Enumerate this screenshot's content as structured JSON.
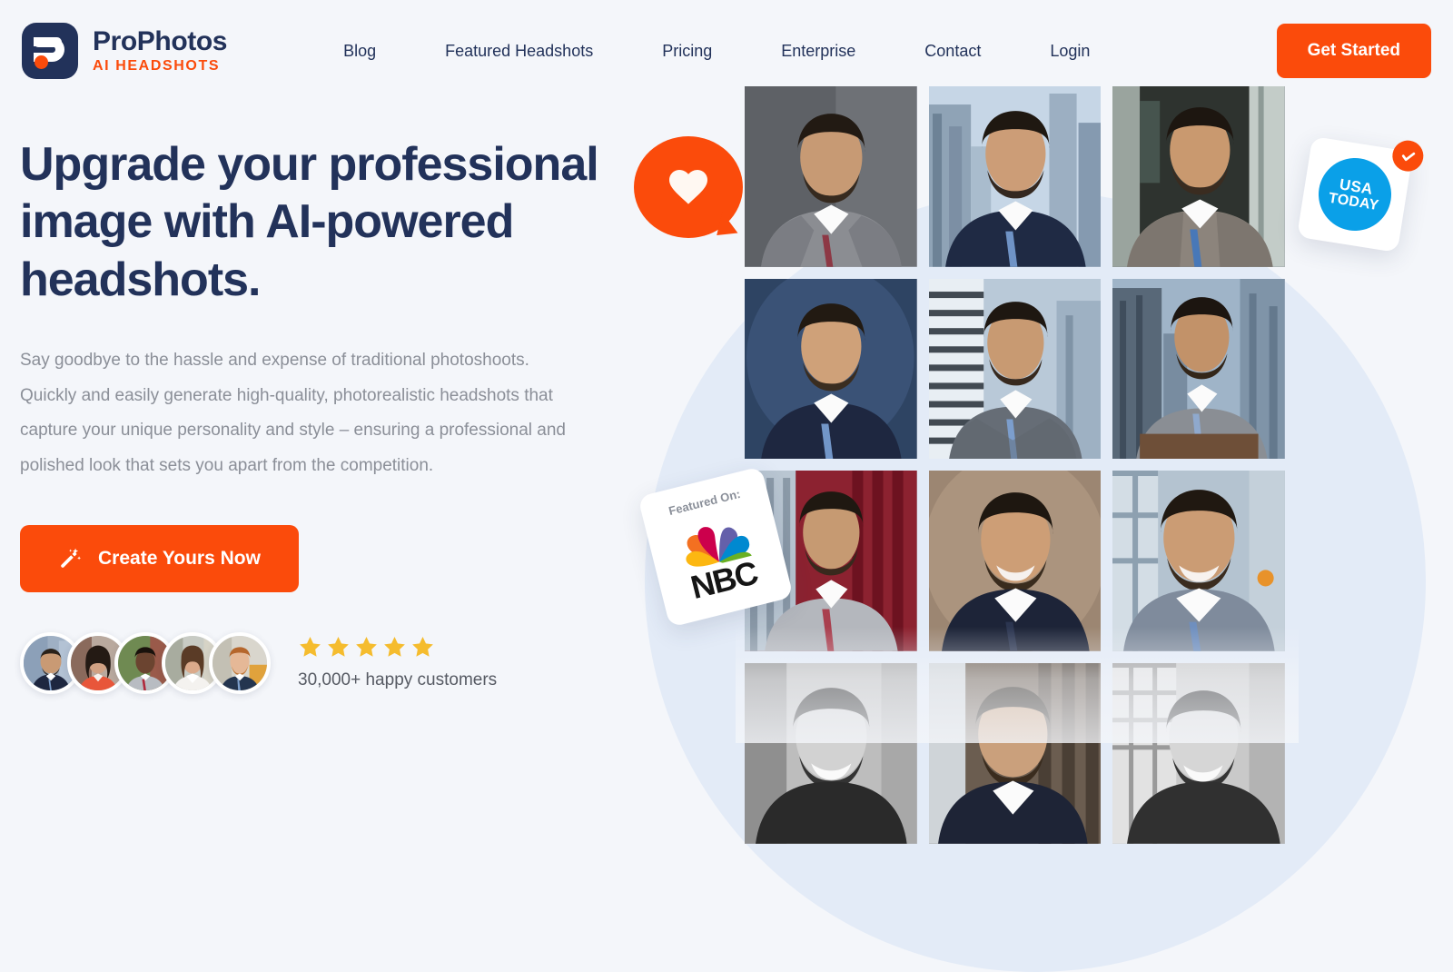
{
  "brand": {
    "name": "ProPhotos",
    "tagline": "AI HEADSHOTS",
    "mark_icon": "prophotos-logo-icon"
  },
  "nav": {
    "items": [
      {
        "label": "Blog"
      },
      {
        "label": "Featured Headshots"
      },
      {
        "label": "Pricing"
      },
      {
        "label": "Enterprise"
      },
      {
        "label": "Contact"
      },
      {
        "label": "Login"
      }
    ],
    "cta_label": "Get Started"
  },
  "hero": {
    "heading": "Upgrade your professional image with AI-powered headshots.",
    "paragraph": "Say goodbye to the hassle and expense of traditional photoshoots. Quickly and easily generate high-quality, photorealistic headshots that capture your unique personality and style – ensuring a professional and polished look that sets you apart from the competition.",
    "cta_label": "Create Yours Now",
    "cta_icon": "magic-wand-icon"
  },
  "social_proof": {
    "star_count": 5,
    "star_icon": "star-icon",
    "customers_text": "30,000+ happy customers",
    "avatars": [
      {
        "name": "customer-avatar-1"
      },
      {
        "name": "customer-avatar-2"
      },
      {
        "name": "customer-avatar-3"
      },
      {
        "name": "customer-avatar-4"
      },
      {
        "name": "customer-avatar-5"
      }
    ]
  },
  "badges": {
    "heart": {
      "icon": "heart-icon"
    },
    "usa_today": {
      "line1": "USA",
      "line2": "TODAY",
      "verified_icon": "check-icon"
    },
    "nbc": {
      "label": "Featured On:",
      "wordmark": "NBC",
      "icon": "nbc-peacock-icon"
    }
  },
  "gallery": {
    "rows": 4,
    "columns": 3,
    "items": [
      {
        "alt": "headshot-gray-backdrop-burgundy-tie"
      },
      {
        "alt": "headshot-city-skyline-navy-suit"
      },
      {
        "alt": "headshot-office-window-plaid-coat"
      },
      {
        "alt": "headshot-blue-backdrop-navy-suit"
      },
      {
        "alt": "headshot-striped-building-gray-suit"
      },
      {
        "alt": "headshot-skyline-gray-suit-desk"
      },
      {
        "alt": "headshot-red-pillars-light-suit"
      },
      {
        "alt": "headshot-brown-backdrop-smiling"
      },
      {
        "alt": "headshot-window-light-blue-suit"
      },
      {
        "alt": "headshot-bw-smiling"
      },
      {
        "alt": "headshot-blurred-office"
      },
      {
        "alt": "headshot-bw-skyline"
      }
    ]
  },
  "colors": {
    "accent": "#fb4b0b",
    "navy": "#22325a",
    "page_bg": "#f4f6fa",
    "blob": "#e3ebf7",
    "star": "#f5bc2e",
    "usa_blue": "#0aa0e8"
  }
}
